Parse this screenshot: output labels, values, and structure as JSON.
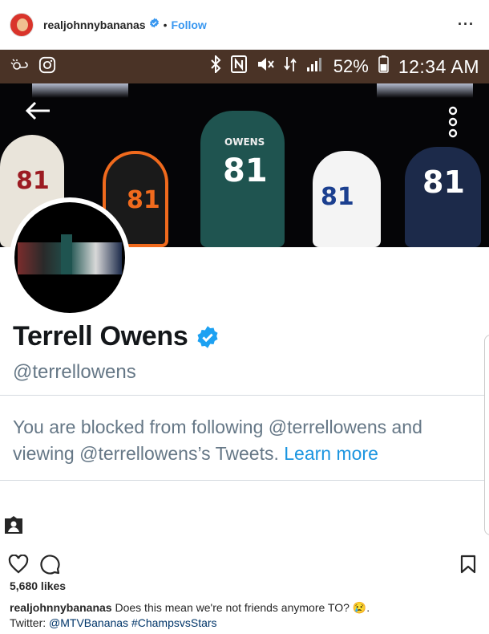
{
  "post_header": {
    "username": "realjohnnybananas",
    "separator": "•",
    "follow_label": "Follow",
    "more_label": "···"
  },
  "screenshot": {
    "statusbar": {
      "battery": "52%",
      "time": "12:34 AM"
    },
    "banner": {
      "jerseys": [
        "81",
        "81",
        "OWENS",
        "81",
        "81",
        "81"
      ]
    },
    "profile": {
      "name": "Terrell Owens",
      "handle": "@terrellowens"
    },
    "blocked_message": {
      "text": "You are blocked from following @terrellowens and viewing @terrellowens’s Tweets.",
      "link": "Learn more"
    }
  },
  "post_actions": {
    "likes": "5,680 likes"
  },
  "caption": {
    "username": "realjohnnybananas",
    "text": "Does this mean we're not friends anymore TO? 😢.",
    "twitter_label": "Twitter:",
    "handle_link": "@MTVBananas",
    "hashtag": "#ChampsvsStars"
  },
  "colors": {
    "ig_link": "#3897f0",
    "twitter_blue": "#1b95e0",
    "statusbar_bg": "#4a3326",
    "muted_text": "#657786"
  },
  "icons": [
    "verified-badge-icon",
    "more-options-icon",
    "back-arrow-icon",
    "kebab-menu-icon",
    "heart-icon",
    "comment-icon",
    "bookmark-icon",
    "tagged-user-icon",
    "bluetooth-icon",
    "nfc-icon",
    "mute-icon",
    "signal-icon",
    "battery-icon",
    "instagram-icon"
  ]
}
